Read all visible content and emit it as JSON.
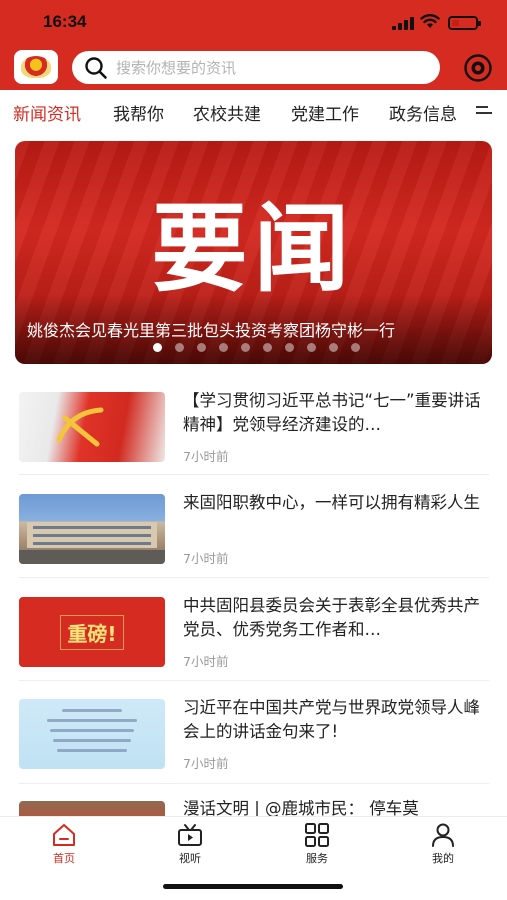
{
  "status_bar": {
    "time": "16:34"
  },
  "search": {
    "placeholder": "搜索你想要的资讯"
  },
  "tabs": [
    {
      "label": "新闻资讯",
      "active": true
    },
    {
      "label": "我帮你",
      "active": false
    },
    {
      "label": "农校共建",
      "active": false
    },
    {
      "label": "党建工作",
      "active": false
    },
    {
      "label": "政务信息",
      "active": false
    }
  ],
  "banner": {
    "big_text": "要闻",
    "caption": "姚俊杰会见春光里第三批包头投资考察团杨守彬一行",
    "dots_total": 10,
    "dots_active_index": 0
  },
  "news": [
    {
      "title": "【学习贯彻习近平总书记“七一”重要讲话精神】党领导经济建设的…",
      "time": "7小时前",
      "thumb": "party-emblem-image"
    },
    {
      "title": "来固阳职教中心，一样可以拥有精彩人生",
      "time": "7小时前",
      "thumb": "school-building-image"
    },
    {
      "title": "中共固阳县委员会关于表彰全县优秀共产党员、优秀党务工作者和…",
      "time": "7小时前",
      "thumb": "heavy-news-image",
      "thumb_text": "重磅!"
    },
    {
      "title": "习近平在中国共产党与世界政党领导人峰会上的讲话金句来了!",
      "time": "7小时前",
      "thumb": "quote-card-image"
    },
    {
      "title": "漫话文明 | @鹿城市民： 停车莫",
      "time": "",
      "thumb": "street-building-image"
    }
  ],
  "bottom_nav": [
    {
      "label": "首页",
      "icon": "home-icon",
      "active": true
    },
    {
      "label": "视听",
      "icon": "video-icon",
      "active": false
    },
    {
      "label": "服务",
      "icon": "grid-icon",
      "active": false
    },
    {
      "label": "我的",
      "icon": "user-icon",
      "active": false
    }
  ],
  "colors": {
    "brand_red": "#d52b20",
    "active_tab": "#d52b20",
    "muted_text": "#9a9a9a"
  }
}
